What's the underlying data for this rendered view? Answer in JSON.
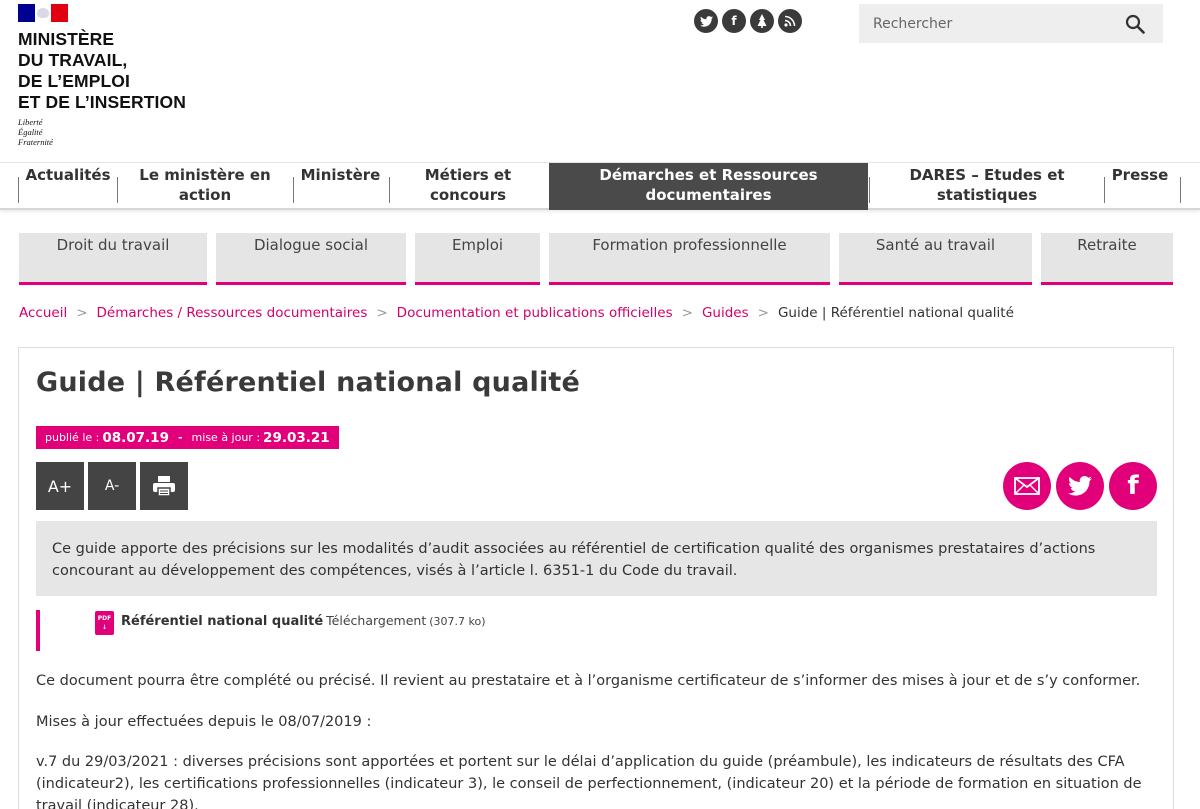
{
  "header": {
    "ministry_lines": [
      "MINISTÈRE",
      "DU TRAVAIL,",
      "DE L’EMPLOI",
      "ET DE L’INSERTION"
    ],
    "motto_lines": [
      "Liberté",
      "Égalité",
      "Fraternité"
    ],
    "social_icons": [
      "twitter-icon",
      "facebook-icon",
      "rss-icon"
    ],
    "search_placeholder": "Rechercher"
  },
  "main_nav": [
    {
      "label": "Actualités",
      "active": false
    },
    {
      "label": "Le ministère en action",
      "active": false
    },
    {
      "label": "Ministère",
      "active": false
    },
    {
      "label": "Métiers et concours",
      "active": false
    },
    {
      "label": "Démarches et Ressources documentaires",
      "active": true
    },
    {
      "label": "DARES – Etudes et statistiques",
      "active": false
    },
    {
      "label": "Presse",
      "active": false
    }
  ],
  "sub_nav": [
    "Droit du travail",
    "Dialogue social",
    "Emploi",
    "Formation professionnelle",
    "Santé au travail",
    "Retraite"
  ],
  "breadcrumb": {
    "links": [
      "Accueil",
      "Démarches / Ressources documentaires",
      "Documentation et publications officielles",
      "Guides"
    ],
    "current": "Guide | Référentiel national qualité"
  },
  "article": {
    "title": "Guide | Référentiel national qualité",
    "published_label": "publié le :",
    "published_date": "08.07.19",
    "updated_label": "mise à jour :",
    "updated_date": "29.03.21",
    "tools": {
      "increase": "A+",
      "decrease": "A-"
    },
    "intro": "Ce guide apporte des précisions sur les modalités d’audit associées au référentiel de certification qualité des organismes prestataires d’actions concourant au développement des compétences, visés à l’article l. 6351-1 du Code du travail.",
    "download": {
      "icon_label": "PDF",
      "name": "Référentiel national qualité",
      "action": "Téléchargement",
      "size": "(307.7 ko)"
    },
    "paragraphs": [
      "Ce document pourra être complété ou précisé. Il revient au prestataire et à l’organisme certificateur de s’informer des mises à jour et de s’y conformer.",
      "Mises à jour effectuées depuis le 08/07/2019 :",
      "v.7 du 29/03/2021 : diverses précisions sont apportées et portent sur le délai d’application du guide (préambule), les indicateurs de résultats des CFA (indicateur2), les certifications professionnelles (indicateur 3), le conseil de perfectionnement, (indicateur 20) et la période de formation en situation de travail (indicateur 28)."
    ]
  },
  "colors": {
    "accent": "#e2007a",
    "dark": "#4a4a4a",
    "grey_bg": "#e6e6e6"
  }
}
